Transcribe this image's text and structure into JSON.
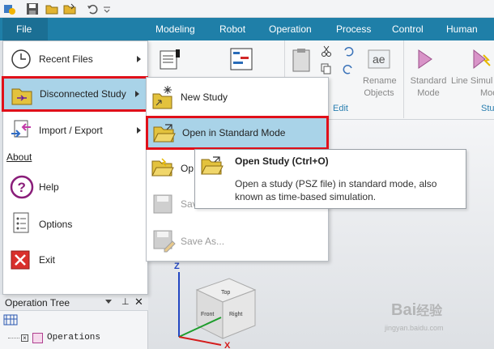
{
  "quick_access": {
    "icons": [
      "app-icon",
      "save-icon",
      "open-icon",
      "open-folder-icon",
      "undo-icon",
      "dropdown-icon"
    ]
  },
  "ribbon": {
    "file_tab": "File",
    "tabs": [
      "Modeling",
      "Robot",
      "Operation",
      "Process",
      "Control",
      "Human"
    ],
    "edit_group": "Edit",
    "rename_objects": [
      "Rename",
      "Objects"
    ],
    "standard_mode": [
      "Standard",
      "Mode"
    ],
    "line_simulation": [
      "Line Simul",
      "Mode"
    ],
    "study_group_partial": "Stu"
  },
  "file_menu": {
    "recent_files": "Recent Files",
    "disconnected_study": "Disconnected Study",
    "import_export": "Import / Export",
    "about": "About",
    "help": "Help",
    "options": "Options",
    "exit": "Exit"
  },
  "submenu": {
    "new_study": "New Study",
    "open_standard": "Open in Standard Mode",
    "open_partial": "Op",
    "save_partial": "Sav",
    "save_partial_2": "Sav",
    "save_as": "Save As..."
  },
  "tooltip": {
    "title": "Open Study (Ctrl+O)",
    "line1": "Open a study (PSZ file) in standard mode, also",
    "line2": "known as time-based simulation."
  },
  "operation_tree": {
    "title": "Operation Tree",
    "pin": "ᵖ",
    "root": "Operations"
  },
  "viewcube": {
    "top": "Top",
    "front": "Front",
    "right": "Right",
    "axis_z": "Z",
    "axis_x": "X"
  },
  "watermark": {
    "brand": "Bai",
    "brand2": "经验",
    "url": "jingyan.baidu.com"
  },
  "colors": {
    "ribbon_blue": "#1f7fa8",
    "highlight_red": "#e0101a",
    "selected_item": "#a9d3e8"
  }
}
